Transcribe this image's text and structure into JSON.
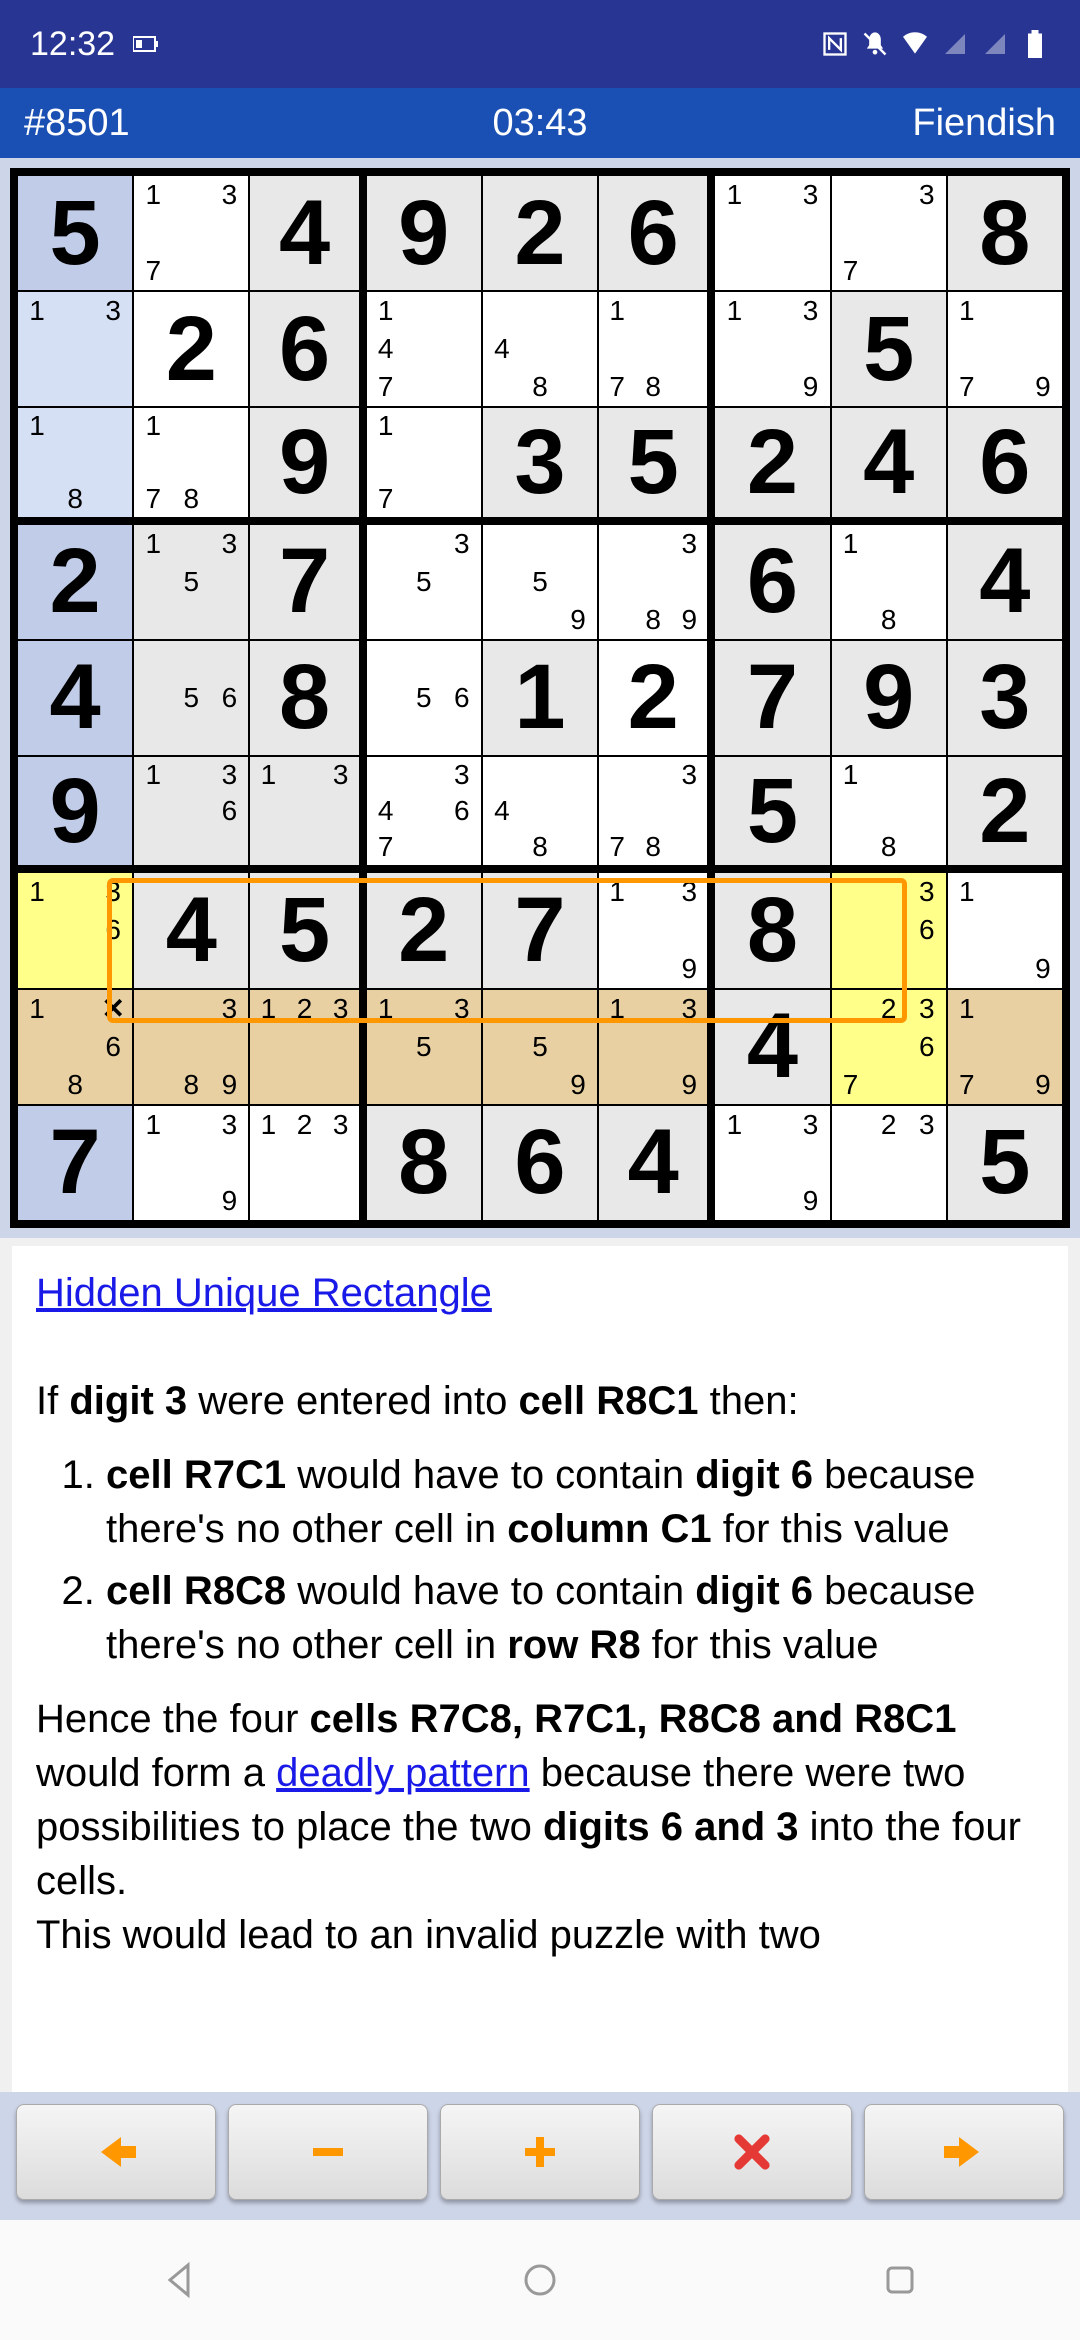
{
  "status": {
    "time": "12:32",
    "icons": [
      "nfc",
      "notif-off",
      "wifi",
      "signal-1",
      "signal-2",
      "battery"
    ]
  },
  "appbar": {
    "puzzle_id": "#8501",
    "timer": "03:43",
    "difficulty": "Fiendish"
  },
  "grid": {
    "cells": [
      [
        {
          "v": "5",
          "t": "big",
          "bg": "bluecol given"
        },
        {
          "p": [
            "1",
            "",
            "3",
            "",
            "",
            "",
            "7",
            "",
            ""
          ]
        },
        {
          "v": "4",
          "t": "big",
          "bg": "given"
        },
        {
          "v": "9",
          "t": "big",
          "bg": "given"
        },
        {
          "v": "2",
          "t": "big",
          "bg": "given"
        },
        {
          "v": "6",
          "t": "big",
          "bg": "given"
        },
        {
          "p": [
            "1",
            "",
            "3",
            "",
            "",
            "",
            "",
            "",
            ""
          ]
        },
        {
          "p": [
            "",
            "",
            "3",
            "",
            "",
            "",
            "7",
            "",
            ""
          ]
        },
        {
          "v": "8",
          "t": "big",
          "bg": "given"
        }
      ],
      [
        {
          "p": [
            "1",
            "",
            "3",
            "",
            "",
            "",
            "",
            "",
            ""
          ],
          "bg": "bluecol"
        },
        {
          "v": "2",
          "t": "big"
        },
        {
          "v": "6",
          "t": "big",
          "bg": "given"
        },
        {
          "p": [
            "1",
            "",
            "",
            "4",
            "",
            "",
            "7",
            "",
            ""
          ]
        },
        {
          "p": [
            "",
            "",
            "",
            "4",
            "",
            "",
            "",
            "8",
            ""
          ]
        },
        {
          "p": [
            "1",
            "",
            "",
            "",
            "",
            "",
            "7",
            "8",
            ""
          ]
        },
        {
          "p": [
            "1",
            "",
            "3",
            "",
            "",
            "",
            "",
            "",
            "9"
          ]
        },
        {
          "v": "5",
          "t": "big",
          "bg": "given"
        },
        {
          "p": [
            "1",
            "",
            "",
            "",
            "",
            "",
            "7",
            "",
            "9"
          ]
        }
      ],
      [
        {
          "p": [
            "1",
            "",
            "",
            "",
            "",
            "",
            "",
            "8",
            ""
          ],
          "bg": "bluecol"
        },
        {
          "p": [
            "1",
            "",
            "",
            "",
            "",
            "",
            "7",
            "8",
            ""
          ]
        },
        {
          "v": "9",
          "t": "big",
          "bg": "given"
        },
        {
          "p": [
            "1",
            "",
            "",
            "",
            "",
            "",
            "7",
            "",
            ""
          ]
        },
        {
          "v": "3",
          "t": "big",
          "bg": "given"
        },
        {
          "v": "5",
          "t": "big",
          "bg": "given"
        },
        {
          "v": "2",
          "t": "big",
          "bg": "given"
        },
        {
          "v": "4",
          "t": "big",
          "bg": "given"
        },
        {
          "v": "6",
          "t": "big",
          "bg": "given"
        }
      ],
      [
        {
          "v": "2",
          "t": "big",
          "bg": "bluecol given"
        },
        {
          "p": [
            "1",
            "",
            "3",
            "",
            "5",
            "",
            "",
            "",
            ""
          ],
          "bg": "given"
        },
        {
          "v": "7",
          "t": "big",
          "bg": "given"
        },
        {
          "p": [
            "",
            "",
            "3",
            "",
            "5",
            "",
            "",
            "",
            ""
          ]
        },
        {
          "p": [
            "",
            "",
            "",
            "",
            "5",
            "",
            "",
            "",
            "9"
          ]
        },
        {
          "p": [
            "",
            "",
            "3",
            "",
            "",
            "",
            "",
            "8",
            "9"
          ]
        },
        {
          "v": "6",
          "t": "big",
          "bg": "given"
        },
        {
          "p": [
            "1",
            "",
            "",
            "",
            "",
            "",
            "",
            "8",
            ""
          ]
        },
        {
          "v": "4",
          "t": "big",
          "bg": "given"
        }
      ],
      [
        {
          "v": "4",
          "t": "big",
          "bg": "bluecol given"
        },
        {
          "p": [
            "",
            "",
            "",
            "",
            "5",
            "6",
            "",
            "",
            ""
          ],
          "bg": "given"
        },
        {
          "v": "8",
          "t": "big",
          "bg": "given"
        },
        {
          "p": [
            "",
            "",
            "",
            "",
            "5",
            "6",
            "",
            "",
            ""
          ]
        },
        {
          "v": "1",
          "t": "big",
          "bg": "given"
        },
        {
          "v": "2",
          "t": "big"
        },
        {
          "v": "7",
          "t": "big",
          "bg": "given"
        },
        {
          "v": "9",
          "t": "big",
          "bg": "given"
        },
        {
          "v": "3",
          "t": "big",
          "bg": "given"
        }
      ],
      [
        {
          "v": "9",
          "t": "big",
          "bg": "bluecol given"
        },
        {
          "p": [
            "1",
            "",
            "3",
            "",
            "",
            "6",
            "",
            "",
            ""
          ],
          "bg": "given"
        },
        {
          "p": [
            "1",
            "",
            "3",
            "",
            "",
            "",
            "",
            "",
            ""
          ],
          "bg": "given"
        },
        {
          "p": [
            "",
            "",
            "3",
            "4",
            "",
            "6",
            "7",
            "",
            ""
          ]
        },
        {
          "p": [
            "",
            "",
            "",
            "4",
            "",
            "",
            "",
            "8",
            ""
          ]
        },
        {
          "p": [
            "",
            "",
            "3",
            "",
            "",
            "",
            "7",
            "8",
            ""
          ]
        },
        {
          "v": "5",
          "t": "big",
          "bg": "given"
        },
        {
          "p": [
            "1",
            "",
            "",
            "",
            "",
            "",
            "",
            "8",
            ""
          ]
        },
        {
          "v": "2",
          "t": "big",
          "bg": "given"
        }
      ],
      [
        {
          "p": [
            "1",
            "",
            "3",
            "",
            "",
            "6",
            "",
            "",
            ""
          ],
          "bg": "yellow"
        },
        {
          "v": "4",
          "t": "big",
          "bg": "given"
        },
        {
          "v": "5",
          "t": "big",
          "bg": "given"
        },
        {
          "v": "2",
          "t": "big",
          "bg": "given"
        },
        {
          "v": "7",
          "t": "big",
          "bg": "given"
        },
        {
          "p": [
            "1",
            "",
            "3",
            "",
            "",
            "",
            "",
            "",
            "9"
          ]
        },
        {
          "v": "8",
          "t": "big",
          "bg": "given"
        },
        {
          "p": [
            "",
            "",
            "3",
            "",
            "",
            "6",
            "",
            "",
            ""
          ],
          "bg": "yellow"
        },
        {
          "p": [
            "1",
            "",
            "",
            "",
            "",
            "",
            "",
            "",
            "9"
          ]
        }
      ],
      [
        {
          "p": [
            "1",
            "",
            "X",
            "",
            "",
            "6",
            "",
            "8",
            ""
          ],
          "bg": "tan"
        },
        {
          "p": [
            "",
            "",
            "3",
            "",
            "",
            "",
            "",
            "8",
            "9"
          ],
          "bg": "tan"
        },
        {
          "p": [
            "1",
            "2",
            "3",
            "",
            "",
            "",
            "",
            "",
            ""
          ],
          "bg": "tan"
        },
        {
          "p": [
            "1",
            "",
            "3",
            "",
            "5",
            "",
            "",
            "",
            ""
          ],
          "bg": "tan"
        },
        {
          "p": [
            "",
            "",
            "",
            "",
            "5",
            "",
            "",
            "",
            "9"
          ],
          "bg": "tan"
        },
        {
          "p": [
            "1",
            "",
            "3",
            "",
            "",
            "",
            "",
            "",
            "9"
          ],
          "bg": "tan"
        },
        {
          "v": "4",
          "t": "big",
          "bg": "given"
        },
        {
          "p": [
            "",
            "2",
            "3",
            "",
            "",
            "6",
            "7",
            "",
            ""
          ],
          "bg": "yellow"
        },
        {
          "p": [
            "1",
            "",
            "",
            "",
            "",
            "",
            "7",
            "",
            "9"
          ],
          "bg": "tan"
        }
      ],
      [
        {
          "v": "7",
          "t": "big",
          "bg": "bluecol given"
        },
        {
          "p": [
            "1",
            "",
            "3",
            "",
            "",
            "",
            "",
            "",
            "9"
          ]
        },
        {
          "p": [
            "1",
            "2",
            "3",
            "",
            "",
            "",
            "",
            "",
            ""
          ]
        },
        {
          "v": "8",
          "t": "big",
          "bg": "given"
        },
        {
          "v": "6",
          "t": "big",
          "bg": "given"
        },
        {
          "v": "4",
          "t": "big",
          "bg": "given"
        },
        {
          "p": [
            "1",
            "",
            "3",
            "",
            "",
            "",
            "",
            "",
            "9"
          ]
        },
        {
          "p": [
            "",
            "2",
            "3",
            "",
            "",
            "",
            "",
            "",
            ""
          ]
        },
        {
          "v": "5",
          "t": "big",
          "bg": "given"
        }
      ]
    ]
  },
  "explanation": {
    "title": "Hidden Unique Rectangle",
    "intro_prefix": "If ",
    "intro_digit": "digit 3",
    "intro_mid": " were entered into ",
    "intro_cell": "cell R8C1",
    "intro_suffix": " then:",
    "step1_a": "cell R7C1",
    "step1_b": " would have to contain ",
    "step1_c": "digit 6",
    "step1_d": " because there's no other cell in ",
    "step1_e": "column C1",
    "step1_f": " for this value",
    "step2_a": "cell R8C8",
    "step2_b": " would have to contain ",
    "step2_c": "digit 6",
    "step2_d": " because there's no other cell in ",
    "step2_e": "row R8",
    "step2_f": " for this value",
    "conc_a": "Hence the four ",
    "conc_b": "cells R7C8, R7C1, R8C8 and R8C1",
    "conc_c": " would form a ",
    "conc_link": "deadly pattern",
    "conc_d": " because there were two possibilities to place the two ",
    "conc_e": "digits 6 and 3",
    "conc_f": " into the four cells.",
    "conc_g": "This would lead to an invalid puzzle with two"
  },
  "actions": {
    "prev": "←",
    "minus": "−",
    "plus": "+",
    "cancel": "✖",
    "next": "→"
  }
}
